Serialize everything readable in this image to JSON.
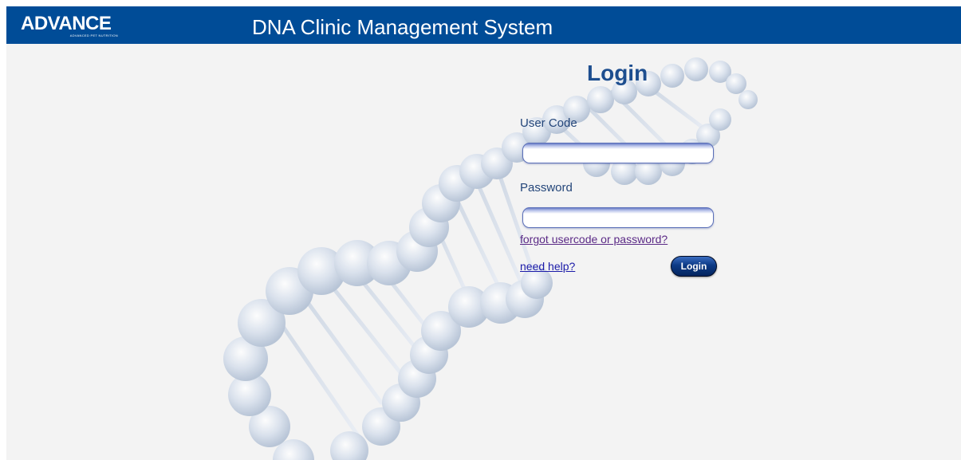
{
  "header": {
    "logo_text": "ADVANCE",
    "logo_tagline": "ADVANCED PET NUTRITION",
    "app_title": "DNA Clinic Management System",
    "background_color": "#004c97"
  },
  "login": {
    "title": "Login",
    "user_code_label": "User Code",
    "user_code_value": "",
    "password_label": "Password",
    "password_value": "",
    "forgot_link": "forgot usercode or password?",
    "help_link": "need help?",
    "submit_label": "Login"
  },
  "background": {
    "image_subject": "dna-double-helix",
    "tint_color": "#c9d6e6"
  }
}
